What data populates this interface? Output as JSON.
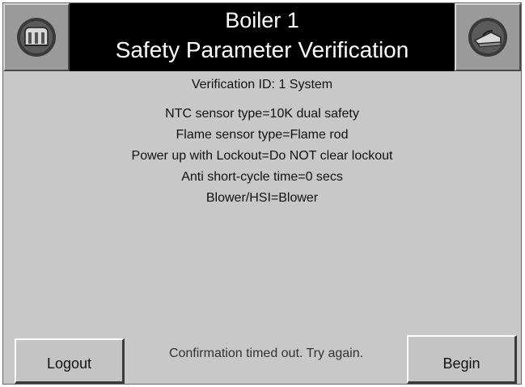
{
  "header": {
    "title_line1": "Boiler 1",
    "title_line2": "Safety Parameter Verification",
    "home_icon": "boiler-home-icon",
    "back_icon": "back-return-icon"
  },
  "content": {
    "verification_id": "Verification ID:  1  System",
    "parameters": [
      "NTC sensor type=10K dual safety",
      "Flame sensor type=Flame rod",
      "Power up with Lockout=Do NOT clear lockout",
      "Anti short-cycle time=0 secs",
      "Blower/HSI=Blower"
    ]
  },
  "footer": {
    "logout_label": "Logout",
    "status_text": "Confirmation timed out. Try again.",
    "begin_label": "Begin"
  },
  "colors": {
    "header_bg": "#000000",
    "screen_bg": "#c8c8c8",
    "icon_gray": "#9a9a9a"
  }
}
